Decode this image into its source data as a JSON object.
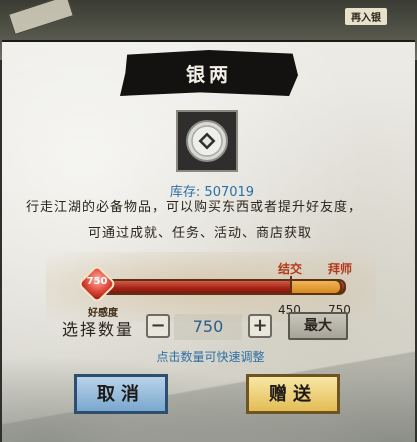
{
  "header": {
    "backdrop_tag": "再入银"
  },
  "dialog": {
    "title": "银两",
    "item_icon": "silver-coin-icon",
    "stock": "库存: 507019",
    "description_line1": "行走江湖的必备物品，可以购买东西或者提升好友度，",
    "description_line2": "可通过成就、任务、活动、商店获取"
  },
  "slider": {
    "current_value": "750",
    "current_label": "好感度",
    "marks": [
      {
        "label": "结交",
        "value": "450"
      },
      {
        "label": "拜师",
        "value": "750"
      }
    ],
    "fill_fraction": 1.0
  },
  "quantity": {
    "label": "选择数量",
    "minus": "−",
    "value": "750",
    "plus": "+",
    "max_label": "最大",
    "hint": "点击数量可快速调整"
  },
  "actions": {
    "cancel": "取消",
    "gift": "赠送"
  },
  "colors": {
    "accent_blue": "#2d6fa4",
    "bar_red": "#a32315",
    "bar_gold": "#d98a1c"
  }
}
